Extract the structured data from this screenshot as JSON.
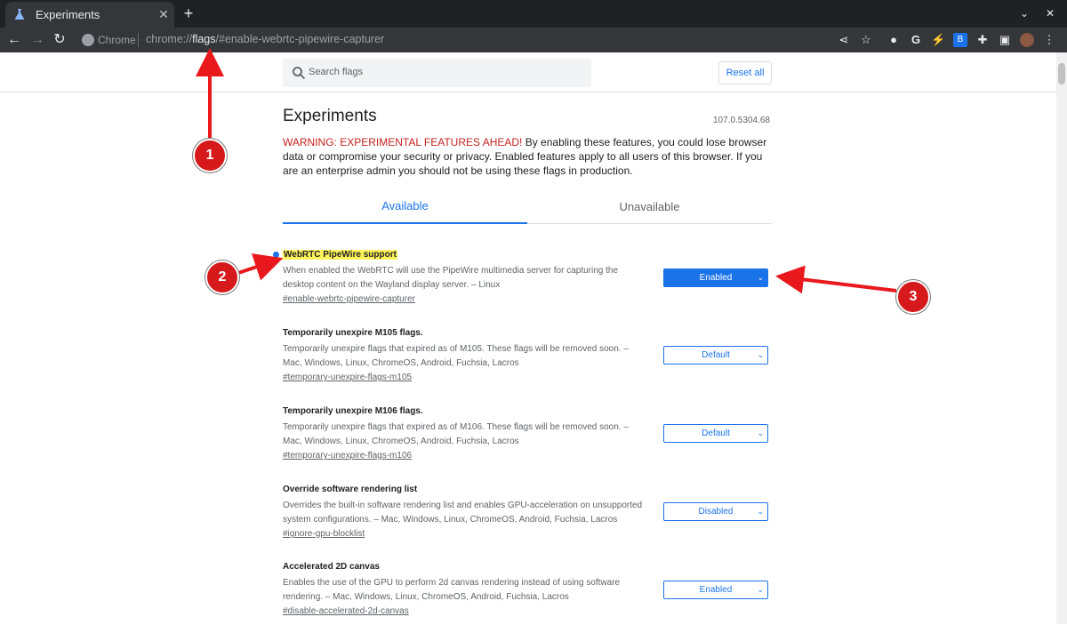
{
  "browser": {
    "tab_title": "Experiments",
    "tab_close": "✕",
    "new_tab": "+",
    "site_label": "Chrome",
    "url_prefix": "chrome://",
    "url_host": "flags",
    "url_rest": "/#enable-webrtc-pipewire-capturer"
  },
  "page": {
    "search_placeholder": "Search flags",
    "reset_label": "Reset all",
    "title": "Experiments",
    "version": "107.0.5304.68",
    "warning_prefix": "WARNING: EXPERIMENTAL FEATURES AHEAD!",
    "warning_text": " By enabling these features, you could lose browser data or compromise your security or privacy. Enabled features apply to all users of this browser. If you are an enterprise admin you should not be using these flags in production.",
    "tabs": [
      "Available",
      "Unavailable"
    ]
  },
  "flags": [
    {
      "name": "WebRTC PipeWire support",
      "description": "When enabled the WebRTC will use the PipeWire multimedia server for capturing the desktop content on the Wayland display server. – Linux",
      "link": "#enable-webrtc-pipewire-capturer",
      "value": "Enabled"
    },
    {
      "name": "Temporarily unexpire M105 flags.",
      "description": "Temporarily unexpire flags that expired as of M105. These flags will be removed soon. – Mac, Windows, Linux, ChromeOS, Android, Fuchsia, Lacros",
      "link": "#temporary-unexpire-flags-m105",
      "value": "Default"
    },
    {
      "name": "Temporarily unexpire M106 flags.",
      "description": "Temporarily unexpire flags that expired as of M106. These flags will be removed soon. – Mac, Windows, Linux, ChromeOS, Android, Fuchsia, Lacros",
      "link": "#temporary-unexpire-flags-m106",
      "value": "Default"
    },
    {
      "name": "Override software rendering list",
      "description": "Overrides the built-in software rendering list and enables GPU-acceleration on unsupported system configurations. – Mac, Windows, Linux, ChromeOS, Android, Fuchsia, Lacros",
      "link": "#ignore-gpu-blocklist",
      "value": "Disabled"
    },
    {
      "name": "Accelerated 2D canvas",
      "description": "Enables the use of the GPU to perform 2d canvas rendering instead of using software rendering. – Mac, Windows, Linux, ChromeOS, Android, Fuchsia, Lacros",
      "link": "#disable-accelerated-2d-canvas",
      "value": "Enabled"
    }
  ],
  "annotations": [
    "1",
    "2",
    "3"
  ],
  "colors": {
    "accent": "#1a73e8",
    "warning": "#c5221f",
    "highlight": "#fff35a",
    "annotation": "#d6191b"
  }
}
